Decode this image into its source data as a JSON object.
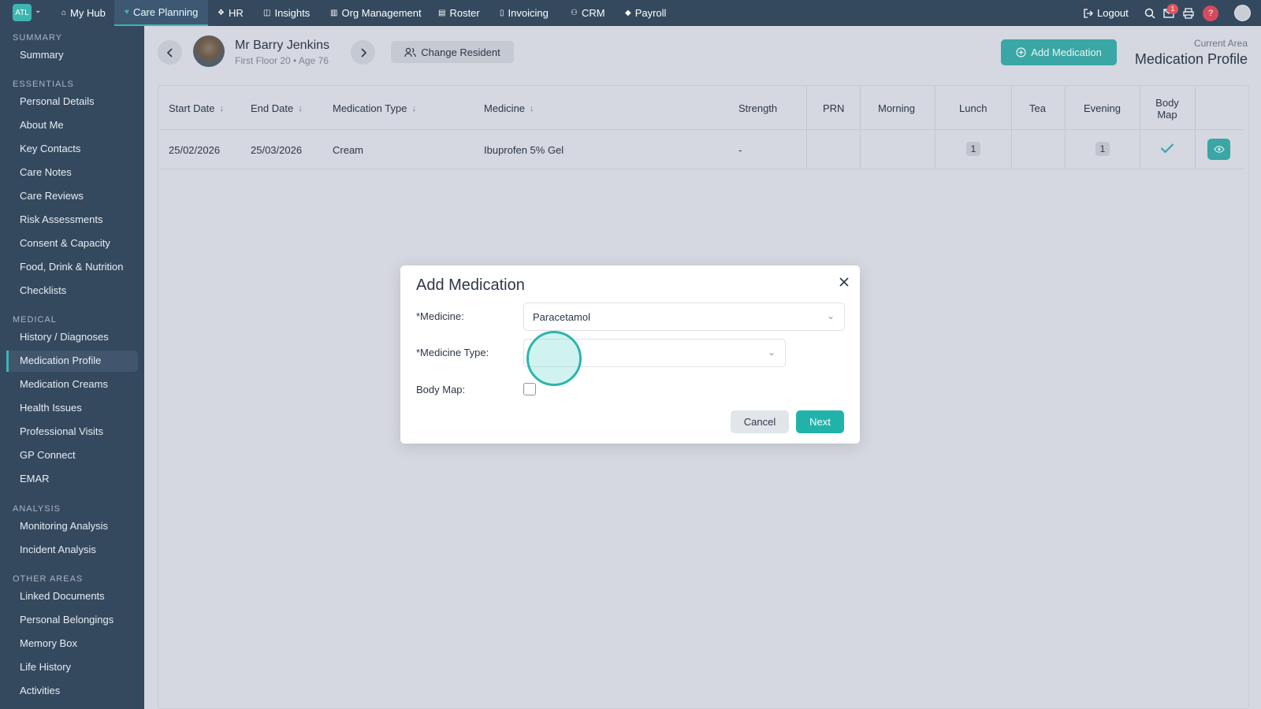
{
  "topnav": {
    "logo": "ATL",
    "items": [
      {
        "icon": "home-icon",
        "glyph": "⌂",
        "label": "My Hub"
      },
      {
        "icon": "heart-icon",
        "glyph": "♥",
        "label": "Care Planning"
      },
      {
        "icon": "people-icon",
        "glyph": "❖",
        "label": "HR"
      },
      {
        "icon": "chart-icon",
        "glyph": "◫",
        "label": "Insights"
      },
      {
        "icon": "building-icon",
        "glyph": "▥",
        "label": "Org Management"
      },
      {
        "icon": "calendar-icon",
        "glyph": "▤",
        "label": "Roster"
      },
      {
        "icon": "file-icon",
        "glyph": "▯",
        "label": "Invoicing"
      },
      {
        "icon": "user-icon",
        "glyph": "⚇",
        "label": "CRM"
      },
      {
        "icon": "diamond-icon",
        "glyph": "◆",
        "label": "Payroll"
      }
    ],
    "logout": "Logout",
    "inbox_badge": "1",
    "help": "?"
  },
  "sidebar": {
    "sections": [
      {
        "title": "SUMMARY",
        "items": [
          "Summary"
        ]
      },
      {
        "title": "ESSENTIALS",
        "items": [
          "Personal Details",
          "About Me",
          "Key Contacts",
          "Care Notes",
          "Care Reviews",
          "Risk Assessments",
          "Consent & Capacity",
          "Food, Drink & Nutrition",
          "Checklists"
        ]
      },
      {
        "title": "MEDICAL",
        "items": [
          "History / Diagnoses",
          "Medication Profile",
          "Medication Creams",
          "Health Issues",
          "Professional Visits",
          "GP Connect",
          "EMAR"
        ]
      },
      {
        "title": "ANALYSIS",
        "items": [
          "Monitoring Analysis",
          "Incident Analysis"
        ]
      },
      {
        "title": "OTHER AREAS",
        "items": [
          "Linked Documents",
          "Personal Belongings",
          "Memory Box",
          "Life History",
          "Activities"
        ]
      }
    ],
    "active": "Medication Profile"
  },
  "resident": {
    "name": "Mr Barry Jenkins",
    "location": "First Floor 20",
    "age": "Age 76",
    "change_label": "Change Resident"
  },
  "header": {
    "add_medication": "Add Medication",
    "current_area_label": "Current Area",
    "current_area": "Medication Profile"
  },
  "table": {
    "columns": [
      "Start Date",
      "End Date",
      "Medication Type",
      "Medicine",
      "Strength",
      "PRN",
      "Morning",
      "Lunch",
      "Tea",
      "Evening",
      "Body Map"
    ],
    "rows": [
      {
        "start": "25/02/2026",
        "end": "25/03/2026",
        "type": "Cream",
        "medicine": "Ibuprofen 5% Gel",
        "strength": "-",
        "prn": "",
        "morning": "",
        "lunch": "1",
        "tea": "",
        "evening": "1",
        "body_map": true
      }
    ]
  },
  "modal": {
    "title": "Add Medication",
    "medicine_label": "*Medicine:",
    "medicine_value": "Paracetamol",
    "type_label": "*Medicine Type:",
    "type_value": "",
    "body_map_label": "Body Map:",
    "body_map_checked": false,
    "cancel": "Cancel",
    "next": "Next"
  },
  "colors": {
    "accent": "#3db5b0",
    "nav_bg": "#34495e",
    "next_button": "#21b3a9"
  }
}
